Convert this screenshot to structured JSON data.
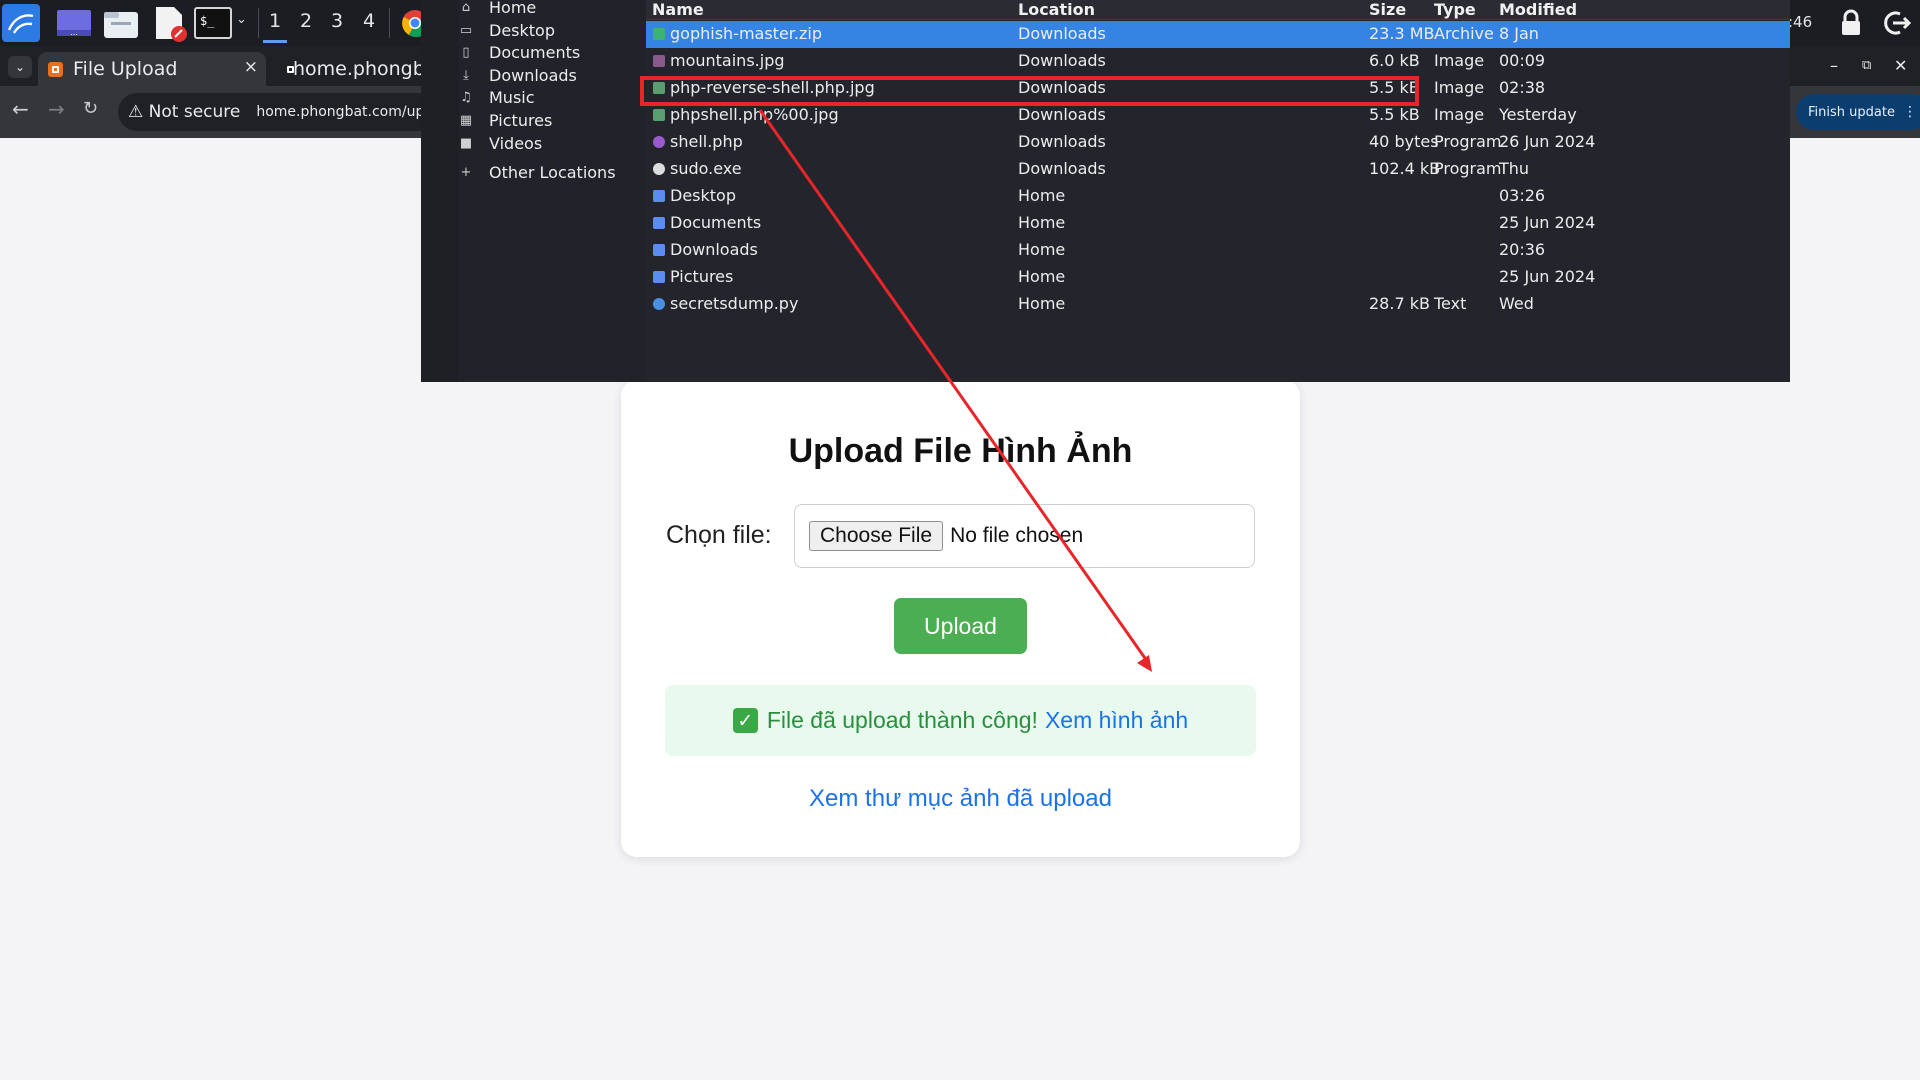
{
  "taskbar": {
    "workspaces": [
      "1",
      "2",
      "3",
      "4"
    ],
    "clock": ":46"
  },
  "browser": {
    "tabs": [
      {
        "label": "File Upload"
      },
      {
        "label": "home.phongbat"
      }
    ],
    "tab_close": "×",
    "not_secure": "⚠ Not secure",
    "url": "home.phongbat.com/upload",
    "finish_update": "Finish update"
  },
  "page": {
    "title": "Upload File Hình Ảnh",
    "choose_label": "Chọn file:",
    "choose_button": "Choose File",
    "no_file": "No file chosen",
    "upload_button": "Upload",
    "success_message": "File đã upload thành công!",
    "success_check": "✓",
    "view_image_link": "Xem hình ảnh",
    "view_folder_link": "Xem thư mục ảnh đã upload"
  },
  "file_dialog": {
    "places": [
      {
        "label": "Home",
        "icon": "home-icon"
      },
      {
        "label": "Desktop",
        "icon": "desktop-icon"
      },
      {
        "label": "Documents",
        "icon": "documents-icon"
      },
      {
        "label": "Downloads",
        "icon": "downloads-icon"
      },
      {
        "label": "Music",
        "icon": "music-icon"
      },
      {
        "label": "Pictures",
        "icon": "pictures-icon"
      },
      {
        "label": "Videos",
        "icon": "videos-icon"
      },
      {
        "label": "Other Locations",
        "icon": "plus-icon"
      }
    ],
    "columns": [
      "Name",
      "Location",
      "Size",
      "Type",
      "Modified"
    ],
    "files": [
      {
        "name": "gophish-master.zip",
        "location": "Downloads",
        "size": "23.3 MB",
        "type": "Archive",
        "modified": "8 Jan",
        "icon": "archive-icon",
        "icon_color": "#3cb371"
      },
      {
        "name": "mountains.jpg",
        "location": "Downloads",
        "size": "6.0 kB",
        "type": "Image",
        "modified": "00:09",
        "icon": "image-icon",
        "icon_color": "#8b5a8c"
      },
      {
        "name": "php-reverse-shell.php.jpg",
        "location": "Downloads",
        "size": "5.5 kB",
        "type": "Image",
        "modified": "02:38",
        "icon": "image-icon",
        "icon_color": "#5a9e6f"
      },
      {
        "name": "phpshell.php%00.jpg",
        "location": "Downloads",
        "size": "5.5 kB",
        "type": "Image",
        "modified": "Yesterday",
        "icon": "image-icon",
        "icon_color": "#5a9e6f"
      },
      {
        "name": "shell.php",
        "location": "Downloads",
        "size": "40 bytes",
        "type": "Program",
        "modified": "26 Jun 2024",
        "icon": "script-icon",
        "icon_color": "#9b59d0"
      },
      {
        "name": "sudo.exe",
        "location": "Downloads",
        "size": "102.4 kB",
        "type": "Program",
        "modified": "Thu",
        "icon": "gear-icon",
        "icon_color": "#dddddd"
      },
      {
        "name": "Desktop",
        "location": "Home",
        "size": "",
        "type": "",
        "modified": "03:26",
        "icon": "folder-icon",
        "icon_color": "#5b8def"
      },
      {
        "name": "Documents",
        "location": "Home",
        "size": "",
        "type": "",
        "modified": "25 Jun 2024",
        "icon": "folder-icon",
        "icon_color": "#5b8def"
      },
      {
        "name": "Downloads",
        "location": "Home",
        "size": "",
        "type": "",
        "modified": "20:36",
        "icon": "folder-icon",
        "icon_color": "#5b8def"
      },
      {
        "name": "Pictures",
        "location": "Home",
        "size": "",
        "type": "",
        "modified": "25 Jun 2024",
        "icon": "folder-icon",
        "icon_color": "#5b8def"
      },
      {
        "name": "secretsdump.py",
        "location": "Home",
        "size": "28.7 kB",
        "type": "Text",
        "modified": "Wed",
        "icon": "python-icon",
        "icon_color": "#4a90e2"
      }
    ],
    "selected_index": 0,
    "highlighted_index": 2
  },
  "annotation": {
    "color": "#e8262a"
  }
}
